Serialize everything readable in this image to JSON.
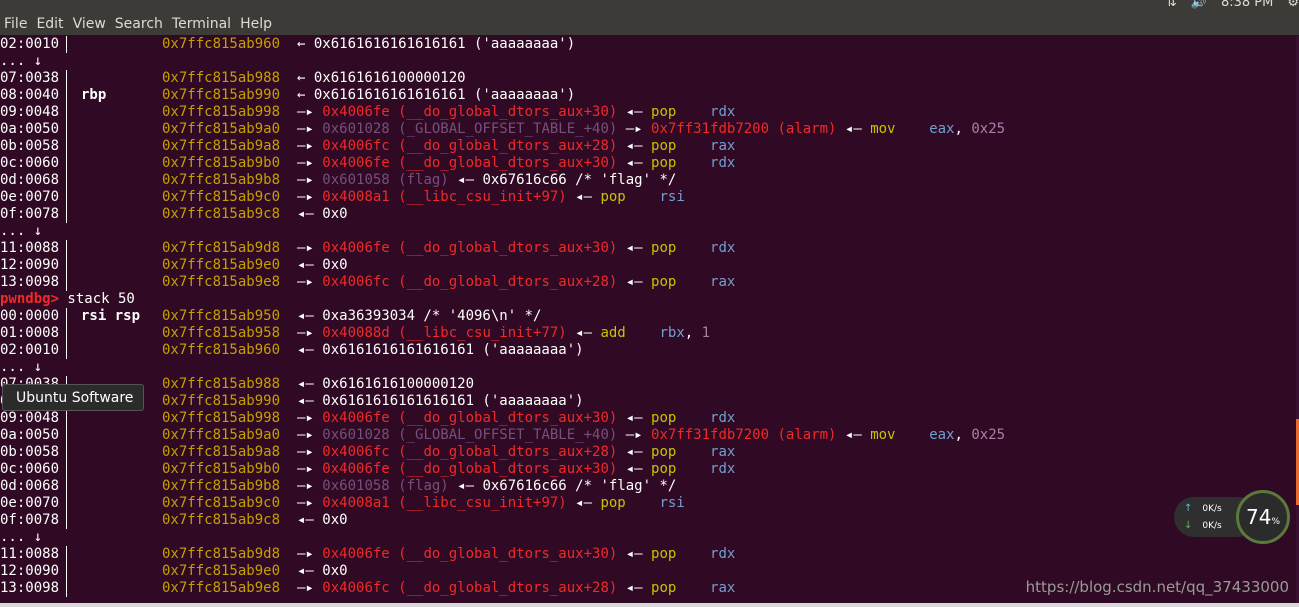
{
  "menubar": {
    "items": [
      "File",
      "Edit",
      "View",
      "Search",
      "Terminal",
      "Help"
    ],
    "clock": "8:38 PM",
    "tray_icons": [
      "network-icon",
      "volume-icon",
      "gear-icon"
    ]
  },
  "terminal": {
    "lines": [
      {
        "off": "02:0010",
        "reg": "",
        "addr": "0x7ffc815ab960",
        "rest": [
          [
            "w",
            "← 0x6161616161616161 ('aaaaaaaa')"
          ]
        ]
      },
      {
        "off": "... ↓",
        "plain": true
      },
      {
        "off": "07:0038",
        "reg": "",
        "addr": "0x7ffc815ab988",
        "rest": [
          [
            "w",
            "← 0x6161616100000120"
          ]
        ]
      },
      {
        "off": "08:0040",
        "reg": "rbp",
        "addr": "0x7ffc815ab990",
        "rest": [
          [
            "w",
            "← 0x6161616161616161 ('aaaaaaaa')"
          ]
        ]
      },
      {
        "off": "09:0048",
        "reg": "",
        "addr": "0x7ffc815ab998",
        "rest": [
          [
            "w",
            "—▸ "
          ],
          [
            "red",
            "0x4006fe (__do_global_dtors_aux+30)"
          ],
          [
            "w",
            " ◂— "
          ],
          [
            "grn",
            "pop    "
          ],
          [
            "blu",
            "rdx"
          ]
        ]
      },
      {
        "off": "0a:0050",
        "reg": "",
        "addr": "0x7ffc815ab9a0",
        "rest": [
          [
            "w",
            "—▸ "
          ],
          [
            "mag",
            "0x601028 (_GLOBAL_OFFSET_TABLE_+40)"
          ],
          [
            "w",
            " —▸ "
          ],
          [
            "red",
            "0x7ff31fdb7200 (alarm)"
          ],
          [
            "w",
            " ◂— "
          ],
          [
            "grn",
            "mov    "
          ],
          [
            "blu",
            "eax"
          ],
          [
            "w",
            ", "
          ],
          [
            "vio",
            "0x25"
          ]
        ]
      },
      {
        "off": "0b:0058",
        "reg": "",
        "addr": "0x7ffc815ab9a8",
        "rest": [
          [
            "w",
            "—▸ "
          ],
          [
            "red",
            "0x4006fc (__do_global_dtors_aux+28)"
          ],
          [
            "w",
            " ◂— "
          ],
          [
            "grn",
            "pop    "
          ],
          [
            "blu",
            "rax"
          ]
        ]
      },
      {
        "off": "0c:0060",
        "reg": "",
        "addr": "0x7ffc815ab9b0",
        "rest": [
          [
            "w",
            "—▸ "
          ],
          [
            "red",
            "0x4006fe (__do_global_dtors_aux+30)"
          ],
          [
            "w",
            " ◂— "
          ],
          [
            "grn",
            "pop    "
          ],
          [
            "blu",
            "rdx"
          ]
        ]
      },
      {
        "off": "0d:0068",
        "reg": "",
        "addr": "0x7ffc815ab9b8",
        "rest": [
          [
            "w",
            "—▸ "
          ],
          [
            "mag",
            "0x601058 (flag)"
          ],
          [
            "w",
            " ◂— 0x67616c66 /* 'flag' */"
          ]
        ]
      },
      {
        "off": "0e:0070",
        "reg": "",
        "addr": "0x7ffc815ab9c0",
        "rest": [
          [
            "w",
            "—▸ "
          ],
          [
            "red",
            "0x4008a1 (__libc_csu_init+97)"
          ],
          [
            "w",
            " ◂— "
          ],
          [
            "grn",
            "pop    "
          ],
          [
            "blu",
            "rsi"
          ]
        ]
      },
      {
        "off": "0f:0078",
        "reg": "",
        "addr": "0x7ffc815ab9c8",
        "rest": [
          [
            "w",
            "◂— 0x0"
          ]
        ]
      },
      {
        "off": "... ↓",
        "plain": true
      },
      {
        "off": "11:0088",
        "reg": "",
        "addr": "0x7ffc815ab9d8",
        "rest": [
          [
            "w",
            "—▸ "
          ],
          [
            "red",
            "0x4006fe (__do_global_dtors_aux+30)"
          ],
          [
            "w",
            " ◂— "
          ],
          [
            "grn",
            "pop    "
          ],
          [
            "blu",
            "rdx"
          ]
        ]
      },
      {
        "off": "12:0090",
        "reg": "",
        "addr": "0x7ffc815ab9e0",
        "rest": [
          [
            "w",
            "◂— 0x0"
          ]
        ]
      },
      {
        "off": "13:0098",
        "reg": "",
        "addr": "0x7ffc815ab9e8",
        "rest": [
          [
            "w",
            "—▸ "
          ],
          [
            "red",
            "0x4006fc (__do_global_dtors_aux+28)"
          ],
          [
            "w",
            " ◂— "
          ],
          [
            "grn",
            "pop    "
          ],
          [
            "blu",
            "rax"
          ]
        ]
      },
      {
        "prompt": "pwndbg>",
        "command": " stack 50"
      },
      {
        "off": "00:0000",
        "reg": "rsi rsp",
        "addr": "0x7ffc815ab950",
        "rest": [
          [
            "w",
            "◂— 0xa36393034 /* '4096\\n' */"
          ]
        ]
      },
      {
        "off": "01:0008",
        "reg": "",
        "addr": "0x7ffc815ab958",
        "rest": [
          [
            "w",
            "—▸ "
          ],
          [
            "red",
            "0x40088d (__libc_csu_init+77)"
          ],
          [
            "w",
            " ◂— "
          ],
          [
            "grn",
            "add    "
          ],
          [
            "blu",
            "rbx"
          ],
          [
            "w",
            ", "
          ],
          [
            "vio",
            "1"
          ]
        ]
      },
      {
        "off": "02:0010",
        "reg": "",
        "addr": "0x7ffc815ab960",
        "rest": [
          [
            "w",
            "◂— 0x6161616161616161 ('aaaaaaaa')"
          ]
        ]
      },
      {
        "off": "... ↓",
        "plain": true
      },
      {
        "off": "07:0038",
        "reg": "",
        "addr": "0x7ffc815ab988",
        "rest": [
          [
            "w",
            "◂— 0x6161616100000120"
          ]
        ]
      },
      {
        "off": "08:0040",
        "reg": "",
        "addr": "0x7ffc815ab990",
        "rest": [
          [
            "w",
            "◂— 0x6161616161616161 ('aaaaaaaa')"
          ]
        ]
      },
      {
        "off": "09:0048",
        "reg": "",
        "addr": "0x7ffc815ab998",
        "rest": [
          [
            "w",
            "—▸ "
          ],
          [
            "red",
            "0x4006fe (__do_global_dtors_aux+30)"
          ],
          [
            "w",
            " ◂— "
          ],
          [
            "grn",
            "pop    "
          ],
          [
            "blu",
            "rdx"
          ]
        ]
      },
      {
        "off": "0a:0050",
        "reg": "",
        "addr": "0x7ffc815ab9a0",
        "rest": [
          [
            "w",
            "—▸ "
          ],
          [
            "mag",
            "0x601028 (_GLOBAL_OFFSET_TABLE_+40)"
          ],
          [
            "w",
            " —▸ "
          ],
          [
            "red",
            "0x7ff31fdb7200 (alarm)"
          ],
          [
            "w",
            " ◂— "
          ],
          [
            "grn",
            "mov    "
          ],
          [
            "blu",
            "eax"
          ],
          [
            "w",
            ", "
          ],
          [
            "vio",
            "0x25"
          ]
        ]
      },
      {
        "off": "0b:0058",
        "reg": "",
        "addr": "0x7ffc815ab9a8",
        "rest": [
          [
            "w",
            "—▸ "
          ],
          [
            "red",
            "0x4006fc (__do_global_dtors_aux+28)"
          ],
          [
            "w",
            " ◂— "
          ],
          [
            "grn",
            "pop    "
          ],
          [
            "blu",
            "rax"
          ]
        ]
      },
      {
        "off": "0c:0060",
        "reg": "",
        "addr": "0x7ffc815ab9b0",
        "rest": [
          [
            "w",
            "—▸ "
          ],
          [
            "red",
            "0x4006fe (__do_global_dtors_aux+30)"
          ],
          [
            "w",
            " ◂— "
          ],
          [
            "grn",
            "pop    "
          ],
          [
            "blu",
            "rdx"
          ]
        ]
      },
      {
        "off": "0d:0068",
        "reg": "",
        "addr": "0x7ffc815ab9b8",
        "rest": [
          [
            "w",
            "—▸ "
          ],
          [
            "mag",
            "0x601058 (flag)"
          ],
          [
            "w",
            " ◂— 0x67616c66 /* 'flag' */"
          ]
        ]
      },
      {
        "off": "0e:0070",
        "reg": "",
        "addr": "0x7ffc815ab9c0",
        "rest": [
          [
            "w",
            "—▸ "
          ],
          [
            "red",
            "0x4008a1 (__libc_csu_init+97)"
          ],
          [
            "w",
            " ◂— "
          ],
          [
            "grn",
            "pop    "
          ],
          [
            "blu",
            "rsi"
          ]
        ]
      },
      {
        "off": "0f:0078",
        "reg": "",
        "addr": "0x7ffc815ab9c8",
        "rest": [
          [
            "w",
            "◂— 0x0"
          ]
        ]
      },
      {
        "off": "... ↓",
        "plain": true
      },
      {
        "off": "11:0088",
        "reg": "",
        "addr": "0x7ffc815ab9d8",
        "rest": [
          [
            "w",
            "—▸ "
          ],
          [
            "red",
            "0x4006fe (__do_global_dtors_aux+30)"
          ],
          [
            "w",
            " ◂— "
          ],
          [
            "grn",
            "pop    "
          ],
          [
            "blu",
            "rdx"
          ]
        ]
      },
      {
        "off": "12:0090",
        "reg": "",
        "addr": "0x7ffc815ab9e0",
        "rest": [
          [
            "w",
            "◂— 0x0"
          ]
        ]
      },
      {
        "off": "13:0098",
        "reg": "",
        "addr": "0x7ffc815ab9e8",
        "rest": [
          [
            "w",
            "—▸ "
          ],
          [
            "red",
            "0x4006fc (__do_global_dtors_aux+28)"
          ],
          [
            "w",
            " ◂— "
          ],
          [
            "grn",
            "pop    "
          ],
          [
            "blu",
            "rax"
          ]
        ]
      }
    ]
  },
  "tooltip": {
    "text": "Ubuntu Software"
  },
  "netmon": {
    "up": "0",
    "down": "0",
    "unit": "K/s",
    "cpu_percent": "74",
    "percent_sign": "%"
  },
  "watermark": "https://blog.csdn.net/qq_37433000",
  "colors": {
    "bg": "#300a24",
    "address": "#c4a000",
    "code": "#ef2929",
    "data": "#75507b",
    "register": "#729fcf",
    "instruction": "#c4c400"
  }
}
